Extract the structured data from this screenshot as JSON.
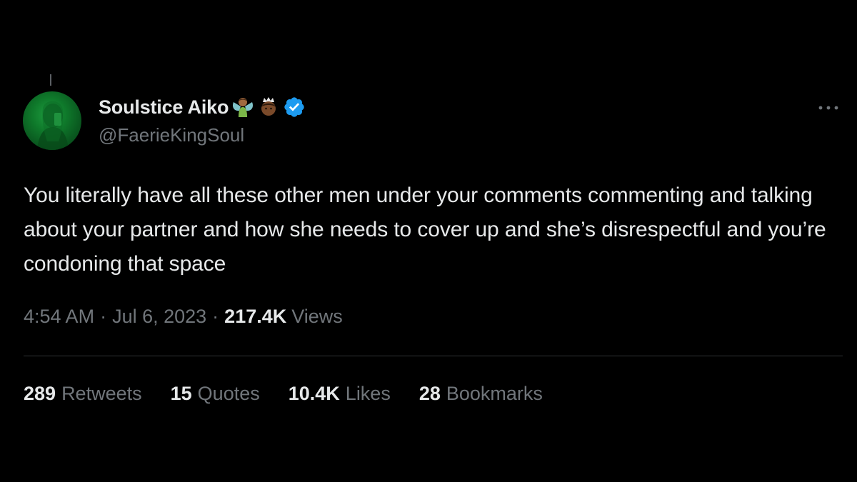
{
  "tweet": {
    "author": {
      "display_name": "Soulstice Aiko",
      "handle": "@FaerieKingSoul",
      "verified": true,
      "emojis": [
        "fairy-emoji",
        "crowned-person-emoji"
      ]
    },
    "text": "You literally have all these other men under your comments commenting and talking about your partner and how she needs to cover up and she’s disrespectful and you’re condoning that space",
    "time": "4:54 AM",
    "date": "Jul 6, 2023",
    "separator": "·",
    "views_count": "217.4K",
    "views_label": "Views",
    "stats": {
      "retweets": {
        "count": "289",
        "label": "Retweets"
      },
      "quotes": {
        "count": "15",
        "label": "Quotes"
      },
      "likes": {
        "count": "10.4K",
        "label": "Likes"
      },
      "bookmarks": {
        "count": "28",
        "label": "Bookmarks"
      }
    }
  },
  "colors": {
    "background": "#000000",
    "primary_text": "#e7e9ea",
    "secondary_text": "#71767b",
    "divider": "#2f3336",
    "verified_blue": "#1d9bf0",
    "avatar_green": "#1f9d40"
  }
}
